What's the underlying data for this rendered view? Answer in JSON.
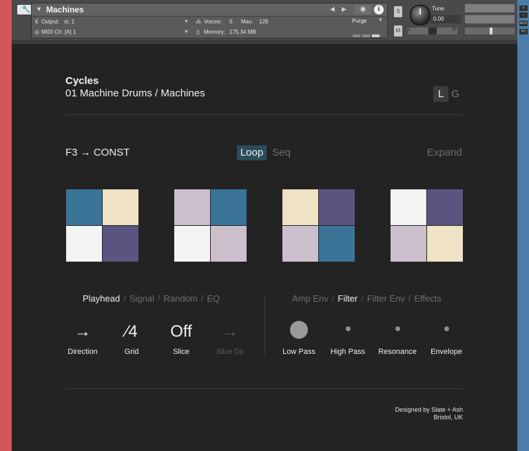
{
  "window": {
    "wrench_glyph": "🔧"
  },
  "header": {
    "instrument_name": "Machines",
    "output_label": "Output:",
    "output_value": "st. 1",
    "voices_label": "Voices:",
    "voices_value": "0",
    "max_label": "Max:",
    "max_value": "128",
    "purge_label": "Purge",
    "midi_label": "MIDI Ch:",
    "midi_value": "[A]  1",
    "memory_label": "Memory:",
    "memory_value": "175.34 MB",
    "s_label": "S",
    "m_label": "M",
    "tune_label": "Tune",
    "tune_value": "0.00",
    "pan_left": "L",
    "pan_center": "C",
    "pan_right": "R",
    "aux_label": "AUX",
    "pv_label": "PV"
  },
  "main": {
    "title": "Cycles",
    "subtitle": "01 Machine Drums / Machines",
    "toggle_l": "L",
    "toggle_g": "G",
    "key_mapping": "F3 → CONST",
    "mode_loop": "Loop",
    "mode_seq": "Seq",
    "expand": "Expand"
  },
  "patterns": [
    {
      "colors": [
        "#3a7598",
        "#f0e2c4",
        "#f4f4f4",
        "#5a5480"
      ]
    },
    {
      "colors": [
        "#cbc0cc",
        "#3a7598",
        "#f4f4f4",
        "#cbc0cc"
      ]
    },
    {
      "colors": [
        "#f0e2c4",
        "#5a5480",
        "#cbc0cc",
        "#3a7598"
      ]
    },
    {
      "colors": [
        "#f4f4f4",
        "#5a5480",
        "#cbc0cc",
        "#f0e2c4"
      ]
    }
  ],
  "left_tabs": [
    "Playhead",
    "Signal",
    "Random",
    "EQ"
  ],
  "right_tabs": [
    "Amp Env",
    "Filter",
    "Filter Env",
    "Effects"
  ],
  "separator": "/",
  "playhead_params": [
    {
      "value": "→",
      "label": "Direction"
    },
    {
      "value": "∕4",
      "label": "Grid"
    },
    {
      "value": "Off",
      "label": "Slice"
    },
    {
      "value": "→",
      "label": "Slice Dir"
    }
  ],
  "filter_params": [
    {
      "label": "Low Pass"
    },
    {
      "label": "High Pass"
    },
    {
      "label": "Resonance"
    },
    {
      "label": "Envelope"
    }
  ],
  "footer": {
    "credit_line1": "Designed by Slate + Ash",
    "credit_line2": "Bristol, UK"
  },
  "colors": {
    "accent_left": "#d4555c",
    "accent_right": "#4a7ea9",
    "loop_active": "#2c4b5b",
    "background": "#232323"
  }
}
